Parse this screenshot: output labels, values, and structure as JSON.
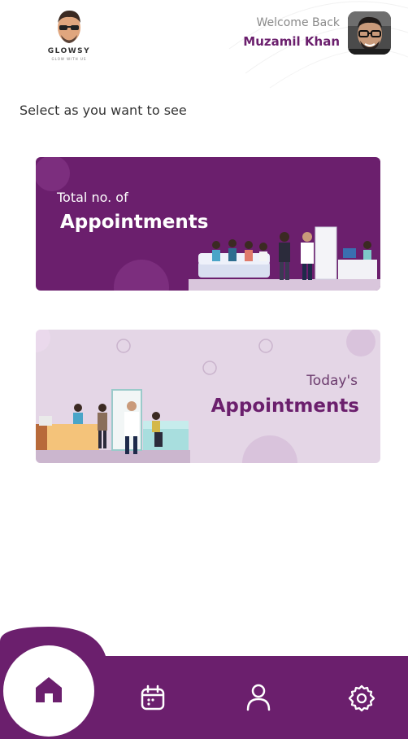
{
  "header": {
    "brand_name": "GLOWSY",
    "brand_tagline": "GLOW WITH US",
    "welcome": "Welcome Back",
    "user_name": "Muzamil Khan"
  },
  "prompt": "Select as you want to see",
  "cards": [
    {
      "id": "total",
      "subtitle": "Total no. of",
      "title": "Appointments"
    },
    {
      "id": "today",
      "subtitle": "Today's",
      "title": "Appointments"
    }
  ],
  "nav": {
    "items": [
      {
        "icon": "home-icon",
        "active": true
      },
      {
        "icon": "calendar-icon",
        "active": false
      },
      {
        "icon": "user-icon",
        "active": false
      },
      {
        "icon": "settings-icon",
        "active": false
      }
    ]
  },
  "colors": {
    "brand": "#6b1f6d",
    "card_light": "#e4d6e6",
    "text_gray": "#8a8a8a"
  }
}
